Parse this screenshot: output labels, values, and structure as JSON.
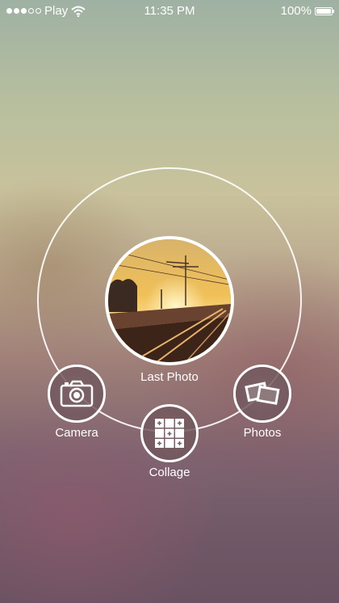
{
  "status_bar": {
    "carrier": "Play",
    "time": "11:35 PM",
    "battery": "100%",
    "signal_bars_filled": 3,
    "signal_bars_total": 5
  },
  "main": {
    "last_photo_label": "Last Photo",
    "camera_label": "Camera",
    "collage_label": "Collage",
    "photos_label": "Photos"
  },
  "icons": {
    "wifi": "wifi-icon",
    "camera": "camera-icon",
    "collage": "collage-grid-icon",
    "photos": "photo-stack-icon"
  },
  "colors": {
    "ring": "#ffffff",
    "button_fill": "#735a5f"
  }
}
